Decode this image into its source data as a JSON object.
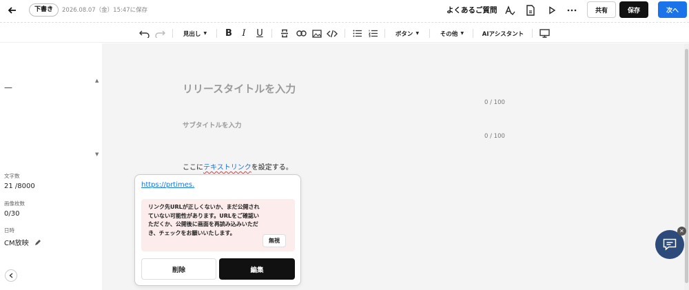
{
  "header": {
    "draft_label": "下書き",
    "save_status": "2026.08.07（金）15:47に保存",
    "faq_label": "よくあるご質問",
    "share_label": "共有",
    "save_label": "保存",
    "next_label": "次へ"
  },
  "toolbar": {
    "heading_label": "見出し",
    "button_label": "ボタン",
    "other_label": "その他",
    "ai_label": "AIアシスタント"
  },
  "sidebar": {
    "dash": "—",
    "char_count_label": "文字数",
    "char_count_value": "21 /8000",
    "image_count_label": "画像枚数",
    "image_count_value": "0/30",
    "date_label": "日時",
    "date_value": "CM放映"
  },
  "editor": {
    "title_placeholder": "リリースタイトルを入力",
    "title_counter": "0 / 100",
    "subtitle_placeholder": "サブタイトルを入力",
    "subtitle_counter": "0 / 100",
    "body_before": "ここに",
    "body_link": "テキストリンク",
    "body_after": "を設定する。"
  },
  "link_popover": {
    "url": "https://prtimes.",
    "warning": "リンク先URLが正しくないか、まだ公開されていない可能性があります。URLをご確認いただくか、公開後に画面を再読み込みいただき、チェックをお願いいたします。",
    "ignore_label": "無視",
    "delete_label": "削除",
    "edit_label": "編集"
  },
  "icons": [
    "back-arrow-icon",
    "font-check-icon",
    "document-icon",
    "play-icon",
    "more-icon",
    "undo-icon",
    "redo-icon",
    "bold-icon",
    "italic-icon",
    "underline-icon",
    "strikethrough-icon",
    "link-icon",
    "image-icon",
    "code-icon",
    "bullet-list-icon",
    "numbered-list-icon",
    "preview-monitor-icon",
    "pencil-icon",
    "chat-icon",
    "close-icon"
  ]
}
